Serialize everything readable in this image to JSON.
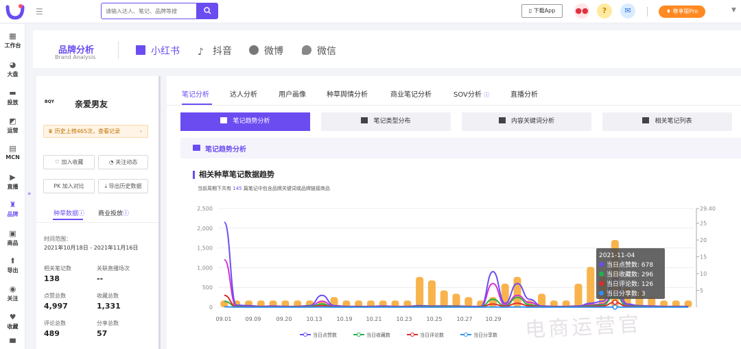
{
  "topbar": {
    "menu_toggle": "☰",
    "search_placeholder": "请输入达人、笔记、品牌等搜",
    "download_label": "下载App",
    "pro_label": "尊享版Pro"
  },
  "sidebar": {
    "items": [
      {
        "label": "工作台",
        "icon": "grid-icon"
      },
      {
        "label": "大盘",
        "icon": "pie-icon"
      },
      {
        "label": "投放",
        "icon": "folder-icon"
      },
      {
        "label": "运营",
        "icon": "chart-icon"
      },
      {
        "label": "MCN",
        "icon": "mcn-icon"
      },
      {
        "label": "直播",
        "icon": "video-icon"
      },
      {
        "label": "品牌",
        "icon": "brand-icon"
      },
      {
        "label": "商品",
        "icon": "bag-icon"
      },
      {
        "label": "导出",
        "icon": "export-icon"
      },
      {
        "label": "关注",
        "icon": "eye-icon"
      },
      {
        "label": "收藏",
        "icon": "heart-icon"
      }
    ]
  },
  "brand_header": {
    "title": "品牌分析",
    "subtitle": "Brand Analysis",
    "platforms": [
      "小红书",
      "抖音",
      "微博",
      "微信"
    ]
  },
  "left_panel": {
    "brand_logo_text": "BQY",
    "brand_name": "亲爱男友",
    "history": "历史上榜465次，查看记录",
    "buttons": {
      "collect": "加入收藏",
      "follow": "关注动态",
      "compare": "PK 加入对比",
      "export": "导出历史数据"
    },
    "tabs": [
      "种草数据",
      "商业投放"
    ],
    "time_range_label": "时间范围：",
    "time_range": "2021年10月18日 - 2021年11月16日",
    "stats": [
      {
        "label": "相关笔记数",
        "value": "138"
      },
      {
        "label": "关联直播场次",
        "value": "--"
      },
      {
        "label": "点赞总数",
        "value": "4,997"
      },
      {
        "label": "收藏总数",
        "value": "1,331"
      },
      {
        "label": "评论总数",
        "value": "489"
      },
      {
        "label": "分享总数",
        "value": "57"
      }
    ]
  },
  "right_panel": {
    "sub_tabs": [
      "笔记分析",
      "达人分析",
      "用户画像",
      "种草舆情分析",
      "商业笔记分析",
      "SOV分析",
      "直播分析"
    ],
    "segments": [
      "笔记趋势分析",
      "笔记类型分布",
      "内容关键词分析",
      "相关笔记列表"
    ],
    "section_title": "笔记趋势分析",
    "chart_title": "相关种草笔记数据趋势",
    "chart_sub_prefix": "当前周期下共有",
    "chart_sub_num": "145",
    "chart_sub_suffix": "篇笔记中包含品牌关键词或品牌链接商品"
  },
  "tooltip": {
    "date": "2021-11-04",
    "rows": [
      {
        "label": "当日点赞数: 678",
        "color": "#6b4cf1"
      },
      {
        "label": "当日收藏数: 296",
        "color": "#22b14c"
      },
      {
        "label": "当日评论数: 126",
        "color": "#e02a2a"
      },
      {
        "label": "当日分享数: 3",
        "color": "#2f8ff0"
      }
    ]
  },
  "legend": [
    {
      "label": "当日点赞数",
      "color": "#6b4cf1"
    },
    {
      "label": "当日收藏数",
      "color": "#22b14c"
    },
    {
      "label": "当日评论数",
      "color": "#e02a2a"
    },
    {
      "label": "当日分享数",
      "color": "#2f8ff0"
    }
  ],
  "watermark": "电商运营官",
  "chart_data": {
    "type": "bar",
    "x_ticks": [
      "09.01",
      "09.09",
      "09.20",
      "10.13",
      "10.19",
      "10.21",
      "10.23",
      "10.25",
      "10.27",
      "10.29"
    ],
    "y_left_ticks": [
      "2,500",
      "2,000",
      "1,500",
      "1,000",
      "500",
      "0"
    ],
    "y_right_ticks": [
      "29.40",
      "25",
      "20",
      "15",
      "10",
      "5"
    ],
    "ylim_left": [
      0,
      2500
    ],
    "ylim_right": [
      0,
      29.4
    ],
    "bars_right_axis": [
      2,
      2,
      2,
      2,
      2,
      2,
      2,
      2,
      2,
      3,
      2,
      2,
      2,
      2,
      2,
      2,
      9,
      8,
      5,
      4,
      3,
      2,
      3,
      7,
      9,
      2,
      4,
      2,
      2,
      7,
      12,
      9,
      20,
      6,
      5,
      3,
      2,
      2,
      2
    ],
    "series": [
      {
        "name": "当日点赞数",
        "color": "#6b4cf1",
        "values": [
          2150,
          50,
          40,
          20,
          30,
          20,
          20,
          40,
          300,
          40,
          20,
          20,
          20,
          30,
          20,
          20,
          40,
          30,
          30,
          30,
          20,
          20,
          900,
          100,
          600,
          200,
          30,
          20,
          20,
          30,
          100,
          150,
          678,
          80,
          40,
          30,
          20,
          20,
          20
        ]
      },
      {
        "name": "当日收藏数",
        "color": "#22b14c",
        "values": [
          150,
          20,
          10,
          10,
          10,
          10,
          10,
          20,
          80,
          10,
          10,
          10,
          10,
          10,
          10,
          10,
          20,
          20,
          20,
          20,
          10,
          10,
          200,
          30,
          250,
          60,
          10,
          10,
          10,
          10,
          40,
          60,
          296,
          30,
          20,
          10,
          10,
          10,
          10
        ]
      },
      {
        "name": "当日评论数",
        "color": "#e02a2a",
        "values": [
          300,
          10,
          10,
          10,
          10,
          10,
          10,
          10,
          40,
          10,
          10,
          10,
          10,
          10,
          10,
          10,
          10,
          10,
          10,
          10,
          10,
          10,
          80,
          20,
          100,
          30,
          10,
          10,
          10,
          10,
          20,
          30,
          126,
          20,
          10,
          10,
          10,
          10,
          10
        ]
      },
      {
        "name": "当日分享数",
        "color": "#2f8ff0",
        "values": [
          10,
          2,
          2,
          2,
          2,
          2,
          2,
          2,
          5,
          2,
          2,
          2,
          2,
          2,
          2,
          2,
          2,
          2,
          2,
          2,
          2,
          2,
          5,
          2,
          5,
          2,
          2,
          2,
          2,
          2,
          2,
          2,
          3,
          2,
          2,
          2,
          2,
          2,
          2
        ]
      }
    ],
    "extra_line_color": "#d62fd6",
    "extra_line_values": [
      1200,
      30,
      20,
      10,
      20,
      10,
      10,
      20,
      150,
      20,
      10,
      10,
      10,
      20,
      10,
      10,
      20,
      20,
      20,
      20,
      10,
      10,
      600,
      60,
      300,
      120,
      20,
      10,
      10,
      20,
      60,
      80,
      400,
      50,
      30,
      20,
      10,
      10,
      10
    ]
  }
}
